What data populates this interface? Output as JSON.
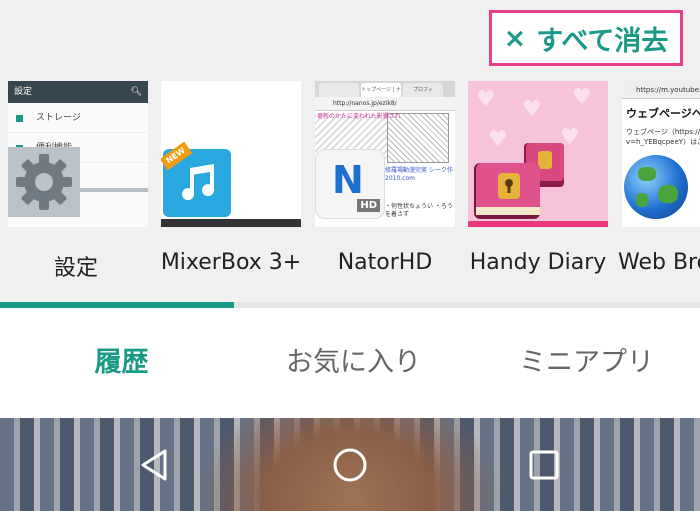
{
  "header": {
    "clear_all_icon": "×",
    "clear_all_label": "すべて消去"
  },
  "apps": [
    {
      "label": "設定",
      "thumb_title": "設定",
      "rows": [
        "ストレージ",
        "便利機能"
      ]
    },
    {
      "label": "MixerBox 3+",
      "badge": "NEW"
    },
    {
      "label": "NatorHD",
      "url": "http://nanos.jp/ezik8/",
      "tabs": [
        "トップページ | ナノ",
        "プロフィ"
      ],
      "icon_letter": "N",
      "icon_badge": "HD",
      "body_text": "更新のかたに変われた影響され",
      "link_text": "修羅場動漫完実 シーク作 2010.com",
      "small_text": "・何性状ちょうい ・ろうを着さず"
    },
    {
      "label": "Handy Diary"
    },
    {
      "label": "Web Bro",
      "url": "https://m.youtube.co",
      "title": "ウェブページへの",
      "text_lines": [
        "ウェブページ（https://m.yo",
        "v=h_YEBqcpeeY）はこの"
      ]
    }
  ],
  "tabs": [
    {
      "label": "履歴",
      "active": true
    },
    {
      "label": "お気に入り",
      "active": false
    },
    {
      "label": "ミニアプリ",
      "active": false
    }
  ],
  "nav": {
    "back": "back-icon",
    "home": "home-icon",
    "recents": "recents-icon"
  },
  "colors": {
    "accent": "#1a9a86",
    "highlight": "#e83e8c"
  }
}
